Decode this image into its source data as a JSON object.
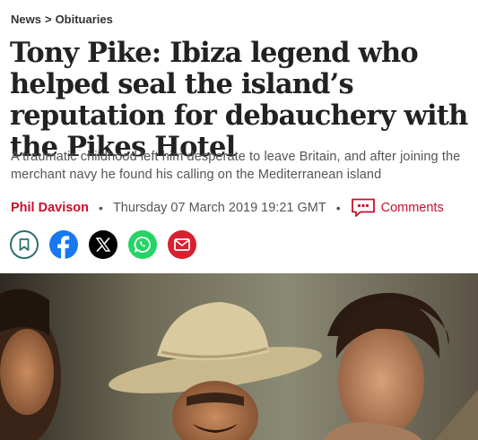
{
  "breadcrumb": {
    "section": "News",
    "separator": ">",
    "subsection": "Obituaries"
  },
  "article": {
    "headline": "Tony Pike: Ibiza legend who helped seal the island’s reputation for debauchery with the Pikes Hotel",
    "standfirst": "A traumatic childhood left him desperate to leave Britain, and after joining the merchant navy he found his calling on the Mediterranean island",
    "author": "Phil Davison",
    "bullet": "•",
    "date": "Thursday 07 March 2019 19:21 GMT",
    "comments_label": "Comments"
  },
  "share": {
    "icons": [
      "bookmark-icon",
      "facebook-icon",
      "x-icon",
      "whatsapp-icon",
      "email-icon"
    ]
  },
  "colors": {
    "accent_red": "#c8102e",
    "facebook": "#1877f2",
    "x": "#000000",
    "whatsapp": "#25d366",
    "email": "#d6212f",
    "bookmark_teal": "#2f6f6a"
  }
}
